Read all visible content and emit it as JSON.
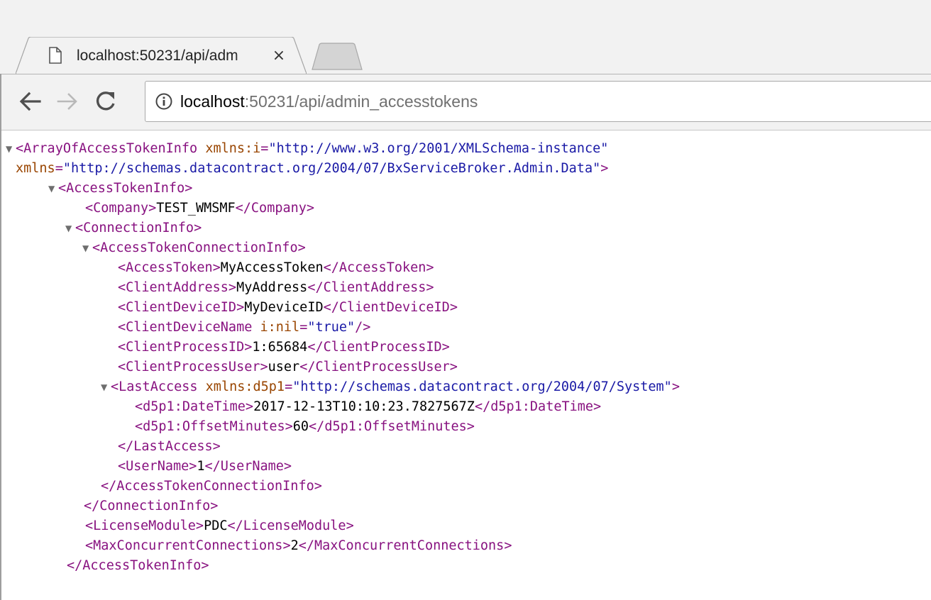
{
  "tab": {
    "title": "localhost:50231/api/adm",
    "close_symbol": "×"
  },
  "address_bar": {
    "host": "localhost",
    "port_path": ":50231/api/admin_accesstokens"
  },
  "icons": {
    "tab": "page-icon",
    "close": "close-icon",
    "back": "back-arrow-icon",
    "forward": "forward-arrow-icon",
    "reload": "reload-icon",
    "info": "info-icon",
    "expand": "triangle-down-icon"
  },
  "colors": {
    "tag": "#881280",
    "attribute_name": "#994500",
    "attribute_value": "#1a1aa6",
    "text": "#000000"
  },
  "xml": {
    "collapse_glyph": "▼",
    "root_open_start": "<ArrayOfAccessTokenInfo",
    "root_attr1_name": "xmlns:i",
    "root_attr1_value": "\"http://www.w3.org/2001/XMLSchema-instance\"",
    "root_attr2_name": "xmlns",
    "root_attr2_value": "\"http://schemas.datacontract.org/2004/07/BxServiceBroker.Admin.Data\"",
    "root_open_end": ">",
    "ati_open": "<AccessTokenInfo>",
    "company_open": "<Company>",
    "company_value": "TEST_WMSMF",
    "company_close": "</Company>",
    "conn_open": "<ConnectionInfo>",
    "atci_open": "<AccessTokenConnectionInfo>",
    "token_open": "<AccessToken>",
    "token_value": "MyAccessToken",
    "token_close": "</AccessToken>",
    "addr_open": "<ClientAddress>",
    "addr_value": "MyAddress",
    "addr_close": "</ClientAddress>",
    "devid_open": "<ClientDeviceID>",
    "devid_value": "MyDeviceID",
    "devid_close": "</ClientDeviceID>",
    "devname_start": "<ClientDeviceName",
    "devname_attr_name": "i:nil",
    "devname_attr_value": "\"true\"",
    "devname_end": "/>",
    "pid_open": "<ClientProcessID>",
    "pid_value": "1:65684",
    "pid_close": "</ClientProcessID>",
    "puser_open": "<ClientProcessUser>",
    "puser_value": "user",
    "puser_close": "</ClientProcessUser>",
    "la_open_start": "<LastAccess",
    "la_attr_name": "xmlns:d5p1",
    "la_attr_value": "\"http://schemas.datacontract.org/2004/07/System\"",
    "la_open_end": ">",
    "dt_open": "<d5p1:DateTime>",
    "dt_value": "2017-12-13T10:10:23.7827567Z",
    "dt_close": "</d5p1:DateTime>",
    "om_open": "<d5p1:OffsetMinutes>",
    "om_value": "60",
    "om_close": "</d5p1:OffsetMinutes>",
    "la_close": "</LastAccess>",
    "un_open": "<UserName>",
    "un_value": "1",
    "un_close": "</UserName>",
    "atci_close": "</AccessTokenConnectionInfo>",
    "conn_close": "</ConnectionInfo>",
    "lm_open": "<LicenseModule>",
    "lm_value": "PDC",
    "lm_close": "</LicenseModule>",
    "mcc_open": "<MaxConcurrentConnections>",
    "mcc_value": "2",
    "mcc_close": "</MaxConcurrentConnections>",
    "ati_close": "</AccessTokenInfo>"
  }
}
